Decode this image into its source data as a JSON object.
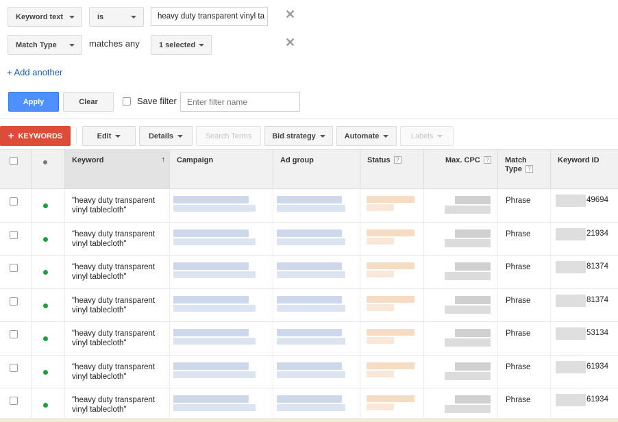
{
  "filters": {
    "row1": {
      "field": "Keyword text",
      "operator": "is",
      "value": "heavy duty transparent vinyl ta"
    },
    "row2": {
      "field": "Match Type",
      "operator_text": "matches any",
      "value": "1 selected"
    },
    "add_another": "+ Add another",
    "apply_label": "Apply",
    "clear_label": "Clear",
    "save_filter_label": "Save filter",
    "filter_name_placeholder": "Enter filter name",
    "remove_icon": "close-icon"
  },
  "toolbar": {
    "keywords_label": "KEYWORDS",
    "edit_label": "Edit",
    "details_label": "Details",
    "search_terms_label": "Search Terms",
    "bid_strategy_label": "Bid strategy",
    "automate_label": "Automate",
    "labels_label": "Labels"
  },
  "table": {
    "headers": {
      "keyword": "Keyword",
      "campaign": "Campaign",
      "ad_group": "Ad group",
      "status": "Status",
      "max_cpc": "Max. CPC",
      "match_type_line1": "Match",
      "match_type_line2": "Type",
      "keyword_id": "Keyword ID",
      "help_icon": "?"
    },
    "sort_indicator": "↑",
    "status_color": "#1e9e45",
    "rows": [
      {
        "keyword_line1": "\"heavy duty transparent",
        "keyword_line2": "vinyl tablecloth\"",
        "match_type": "Phrase",
        "keyword_id_suffix": "49694"
      },
      {
        "keyword_line1": "\"heavy duty transparent",
        "keyword_line2": "vinyl tablecloth\"",
        "match_type": "Phrase",
        "keyword_id_suffix": "21934"
      },
      {
        "keyword_line1": "\"heavy duty transparent",
        "keyword_line2": "vinyl tablecloth\"",
        "match_type": "Phrase",
        "keyword_id_suffix": "81374"
      },
      {
        "keyword_line1": "\"heavy duty transparent",
        "keyword_line2": "vinyl tablecloth\"",
        "match_type": "Phrase",
        "keyword_id_suffix": "81374"
      },
      {
        "keyword_line1": "\"heavy duty transparent",
        "keyword_line2": "vinyl tablecloth\"",
        "match_type": "Phrase",
        "keyword_id_suffix": "53134"
      },
      {
        "keyword_line1": "\"heavy duty transparent",
        "keyword_line2": "vinyl tablecloth\"",
        "match_type": "Phrase",
        "keyword_id_suffix": "61934"
      },
      {
        "keyword_line1": "\"heavy duty transparent",
        "keyword_line2": "vinyl tablecloth\"",
        "match_type": "Phrase",
        "keyword_id_suffix": "61934"
      }
    ]
  },
  "colors": {
    "apply_button": "#4d90fe",
    "keywords_button": "#dd4b39",
    "link": "#1a5fb4"
  }
}
